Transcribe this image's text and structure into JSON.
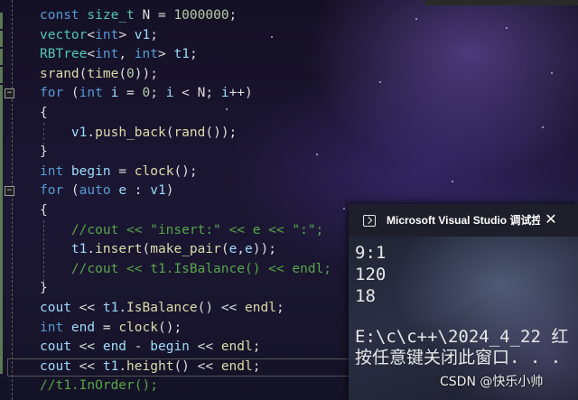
{
  "editor": {
    "lines": [
      [
        [
          "kw",
          "const "
        ],
        [
          "ty",
          "size_t"
        ],
        [
          "tx",
          " N = "
        ],
        [
          "nm",
          "1000000"
        ],
        [
          "tx",
          ";"
        ]
      ],
      [
        [
          "ty",
          "vector"
        ],
        [
          "tx",
          "<"
        ],
        [
          "kw",
          "int"
        ],
        [
          "tx",
          "> "
        ],
        [
          "vr",
          "v1"
        ],
        [
          "tx",
          ";"
        ]
      ],
      [
        [
          "ty",
          "RBTree"
        ],
        [
          "tx",
          "<"
        ],
        [
          "kw",
          "int"
        ],
        [
          "tx",
          ", "
        ],
        [
          "kw",
          "int"
        ],
        [
          "tx",
          "> "
        ],
        [
          "vr",
          "t1"
        ],
        [
          "tx",
          ";"
        ]
      ],
      [
        [
          "fn",
          "srand"
        ],
        [
          "tx",
          "("
        ],
        [
          "fn",
          "time"
        ],
        [
          "tx",
          "("
        ],
        [
          "nm",
          "0"
        ],
        [
          "tx",
          "));"
        ]
      ],
      [
        [
          "kw",
          "for "
        ],
        [
          "tx",
          "("
        ],
        [
          "kw",
          "int "
        ],
        [
          "vr",
          "i"
        ],
        [
          "tx",
          " = "
        ],
        [
          "nm",
          "0"
        ],
        [
          "tx",
          "; "
        ],
        [
          "vr",
          "i"
        ],
        [
          "tx",
          " < N; "
        ],
        [
          "vr",
          "i"
        ],
        [
          "tx",
          "++)"
        ]
      ],
      [
        [
          "tx",
          "{"
        ]
      ],
      [
        [
          "tx",
          "    "
        ],
        [
          "vr",
          "v1"
        ],
        [
          "tx",
          "."
        ],
        [
          "fn",
          "push_back"
        ],
        [
          "tx",
          "("
        ],
        [
          "fn",
          "rand"
        ],
        [
          "tx",
          "());"
        ]
      ],
      [
        [
          "tx",
          "}"
        ]
      ],
      [
        [
          "kw",
          "int "
        ],
        [
          "vr",
          "begin"
        ],
        [
          "tx",
          " = "
        ],
        [
          "fn",
          "clock"
        ],
        [
          "tx",
          "();"
        ]
      ],
      [
        [
          "kw",
          "for "
        ],
        [
          "tx",
          "("
        ],
        [
          "kw",
          "auto "
        ],
        [
          "vr",
          "e"
        ],
        [
          "tx",
          " : "
        ],
        [
          "vr",
          "v1"
        ],
        [
          "tx",
          ")"
        ]
      ],
      [
        [
          "tx",
          "{"
        ]
      ],
      [
        [
          "tx",
          "    "
        ],
        [
          "cm",
          "//cout << \"insert:\" << e << \":\";"
        ]
      ],
      [
        [
          "tx",
          "    "
        ],
        [
          "vr",
          "t1"
        ],
        [
          "tx",
          "."
        ],
        [
          "fn",
          "insert"
        ],
        [
          "tx",
          "("
        ],
        [
          "fn",
          "make_pair"
        ],
        [
          "tx",
          "("
        ],
        [
          "vr",
          "e"
        ],
        [
          "tx",
          ","
        ],
        [
          "vr",
          "e"
        ],
        [
          "tx",
          "));"
        ]
      ],
      [
        [
          "tx",
          "    "
        ],
        [
          "cm",
          "//cout << t1.IsBalance() << endl;"
        ]
      ],
      [
        [
          "tx",
          "}"
        ]
      ],
      [
        [
          "vr",
          "cout"
        ],
        [
          "tx",
          " << "
        ],
        [
          "vr",
          "t1"
        ],
        [
          "tx",
          "."
        ],
        [
          "fn",
          "IsBalance"
        ],
        [
          "tx",
          "() << "
        ],
        [
          "fn",
          "endl"
        ],
        [
          "tx",
          ";"
        ]
      ],
      [
        [
          "kw",
          "int "
        ],
        [
          "vr",
          "end"
        ],
        [
          "tx",
          " = "
        ],
        [
          "fn",
          "clock"
        ],
        [
          "tx",
          "();"
        ]
      ],
      [
        [
          "vr",
          "cout"
        ],
        [
          "tx",
          " << "
        ],
        [
          "vr",
          "end"
        ],
        [
          "tx",
          " - "
        ],
        [
          "vr",
          "begin"
        ],
        [
          "tx",
          " << "
        ],
        [
          "fn",
          "endl"
        ],
        [
          "tx",
          ";"
        ]
      ],
      [
        [
          "vr",
          "cout"
        ],
        [
          "tx",
          " << "
        ],
        [
          "vr",
          "t1"
        ],
        [
          "tx",
          "."
        ],
        [
          "fn",
          "height"
        ],
        [
          "tx",
          "() << "
        ],
        [
          "fn",
          "endl"
        ],
        [
          "tx",
          ";"
        ]
      ],
      [
        [
          "cm",
          "//t1.InOrder();"
        ]
      ]
    ],
    "fold_glyph": "−"
  },
  "console": {
    "title": "Microsoft Visual Studio 调试控",
    "close_glyph": "✕",
    "output": [
      "9:1",
      "120",
      "18",
      "",
      "E:\\c\\c++\\2024_4_22 红",
      "按任意键关闭此窗口. . ."
    ]
  },
  "watermark": "CSDN @快乐小帅"
}
